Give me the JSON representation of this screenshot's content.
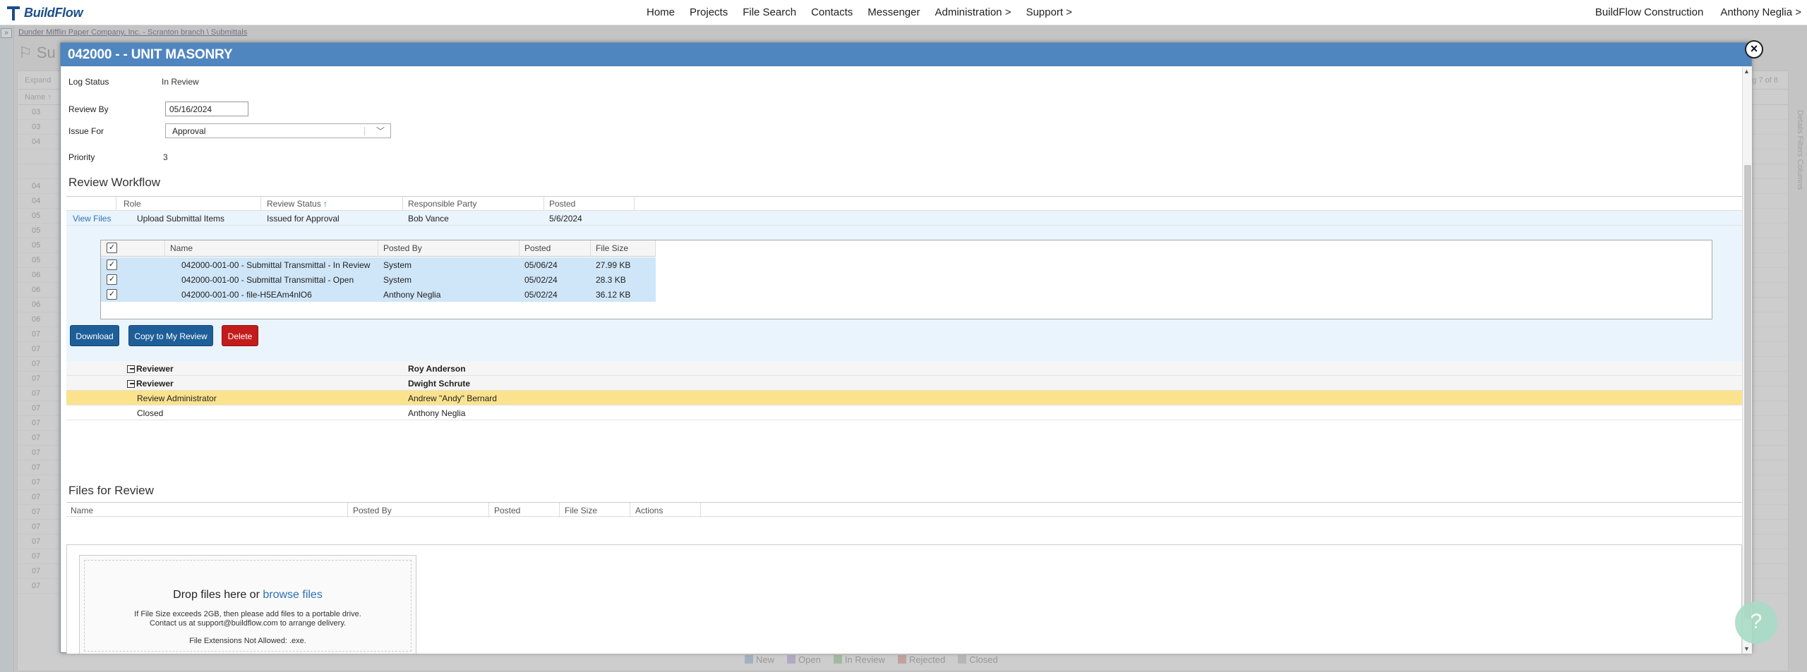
{
  "nav": {
    "logo_text": "BuildFlow",
    "links": [
      "Home",
      "Projects",
      "File Search",
      "Contacts",
      "Messenger",
      "Administration >",
      "Support >"
    ],
    "company": "BuildFlow Construction",
    "user": "Anthony Neglia >"
  },
  "background": {
    "breadcrumb": "Dunder Mifflin Paper Company, Inc. - Scranton branch \\ Submittals",
    "title_fragment": "Su",
    "expand_label": "Expand",
    "name_col": "Name",
    "row_prefixes": [
      "03",
      "03",
      "04",
      "",
      "",
      "04",
      "04",
      "05",
      "05",
      "05",
      "05",
      "06",
      "06",
      "06",
      "06",
      "07",
      "07",
      "07",
      "07",
      "07",
      "07",
      "07",
      "07",
      "07",
      "07",
      "07",
      "07",
      "07",
      "07",
      "07",
      "07",
      "07",
      "07"
    ],
    "paging": "ng 7 of 8",
    "legend": [
      "New",
      "Open",
      "In Review",
      "Rejected",
      "Closed"
    ],
    "legend_colors": [
      "#a9c7e6",
      "#c9b6e6",
      "#a9d8a9",
      "#e6a9a9",
      "#d0d0d0"
    ],
    "side_tabs": "Details  Filters  Columns"
  },
  "modal": {
    "title": "042000 - - UNIT MASONRY",
    "close_label": "×",
    "fields": {
      "log_status_label": "Log Status",
      "log_status_value": "In Review",
      "review_by_label": "Review By",
      "review_by_value": "05/16/2024",
      "issue_for_label": "Issue For",
      "issue_for_value": "Approval",
      "priority_label": "Priority",
      "priority_value": "3"
    },
    "review_workflow": {
      "title": "Review Workflow",
      "headers": [
        "Role",
        "Review Status",
        "Responsible Party",
        "Posted"
      ],
      "sort_indicator": "↑",
      "first_row": {
        "action": "View Files",
        "role": "Upload Submittal Items",
        "status": "Issued for Approval",
        "party": "Bob Vance",
        "posted": "5/6/2024"
      },
      "file_grid": {
        "headers": [
          "Name",
          "Posted By",
          "Posted",
          "File Size"
        ],
        "rows": [
          {
            "name": "042000-001-00 - Submittal Transmittal - In Review",
            "posted_by": "System",
            "posted": "05/06/24",
            "size": "27.99 KB"
          },
          {
            "name": "042000-001-00 - Submittal Transmittal - Open",
            "posted_by": "System",
            "posted": "05/02/24",
            "size": "28.3 KB"
          },
          {
            "name": "042000-001-00 - file-H5EAm4nlO6",
            "posted_by": "Anthony Neglia",
            "posted": "05/02/24",
            "size": "36.12 KB"
          }
        ]
      },
      "buttons": {
        "download": "Download",
        "copy": "Copy to My Review",
        "delete": "Delete"
      },
      "reviewers": [
        {
          "role": "Reviewer",
          "party": "Roy Anderson"
        },
        {
          "role": "Reviewer",
          "party": "Dwight Schrute"
        },
        {
          "role": "Review Administrator",
          "party": "Andrew \"Andy\" Bernard"
        },
        {
          "role": "Closed",
          "party": "Anthony Neglia"
        }
      ]
    },
    "files_for_review": {
      "title": "Files for Review",
      "headers": [
        "Name",
        "Posted By",
        "Posted",
        "File Size",
        "Actions"
      ],
      "drop_text": "Drop files here or",
      "browse_link": "browse files",
      "note_line1": "If File Size exceeds 2GB, then please add files to a portable drive.",
      "note_line2": "Contact us at support@buildflow.com to arrange delivery.",
      "extensions": "File Extensions Not Allowed: .exe."
    },
    "help_label": "?"
  }
}
